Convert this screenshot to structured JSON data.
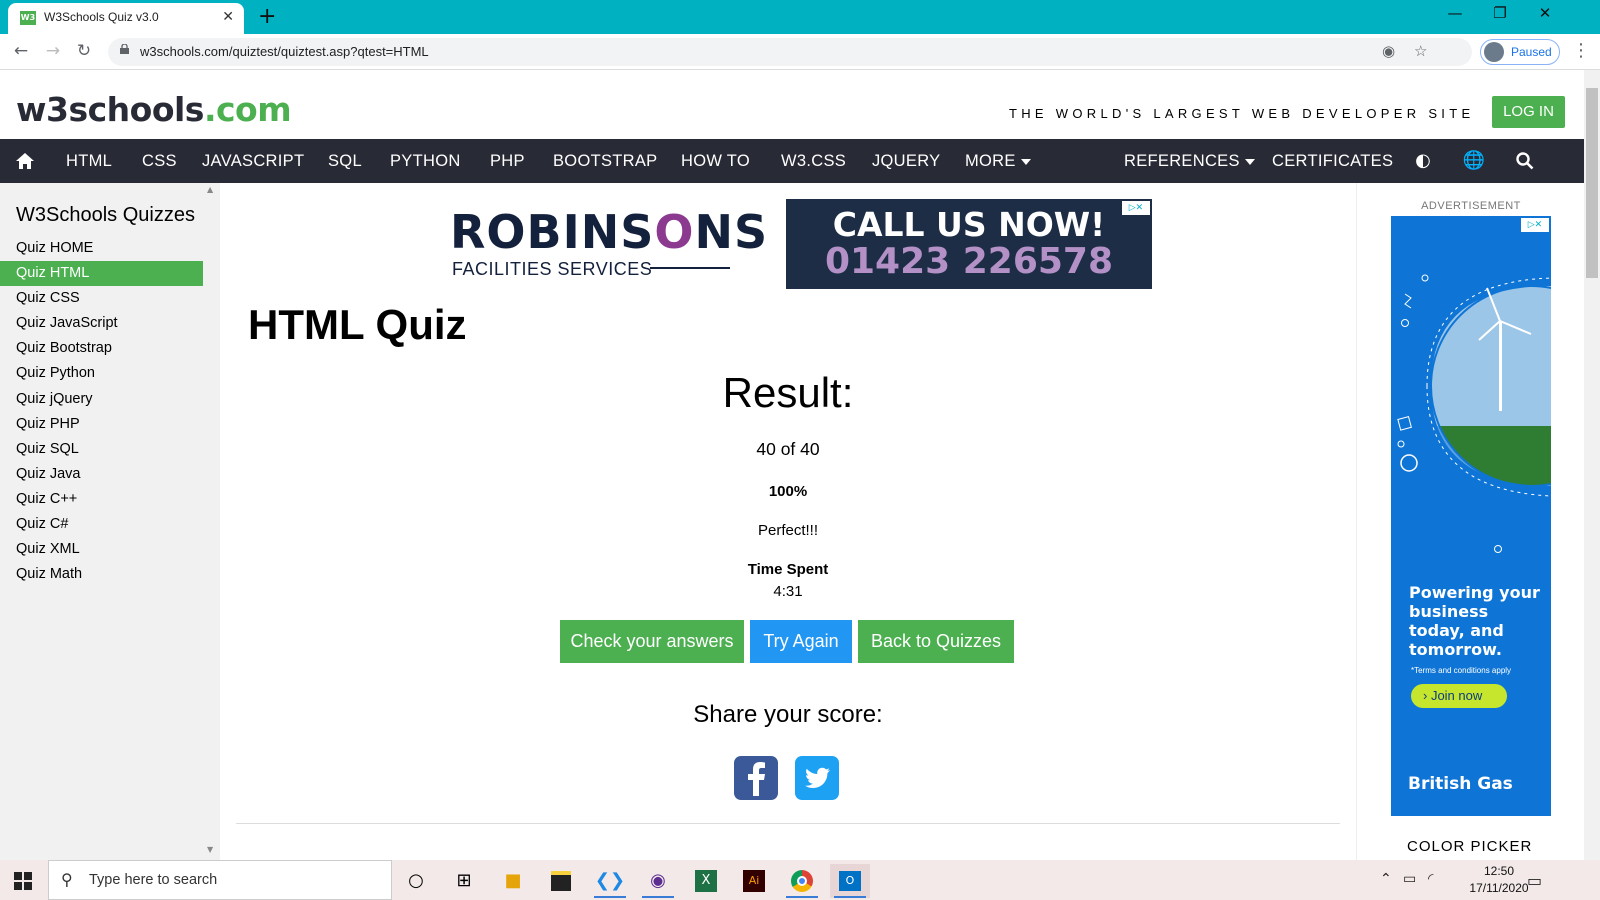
{
  "browser": {
    "tab_title": "W3Schools Quiz v3.0",
    "favicon_text": "W3",
    "url": "w3schools.com/quiztest/quiztest.asp?qtest=HTML",
    "profile_label": "Paused"
  },
  "header": {
    "logo_main": "w3schools",
    "logo_tld": ".com",
    "tagline": "THE WORLD'S LARGEST WEB DEVELOPER SITE",
    "login_label": "LOG IN"
  },
  "topnav": {
    "items": [
      "HTML",
      "CSS",
      "JAVASCRIPT",
      "SQL",
      "PYTHON",
      "PHP",
      "BOOTSTRAP",
      "HOW TO",
      "W3.CSS",
      "JQUERY",
      "MORE",
      "REFERENCES",
      "CERTIFICATES"
    ]
  },
  "sidebar": {
    "title": "W3Schools Quizzes",
    "items": [
      "Quiz HOME",
      "Quiz HTML",
      "Quiz CSS",
      "Quiz JavaScript",
      "Quiz Bootstrap",
      "Quiz Python",
      "Quiz jQuery",
      "Quiz PHP",
      "Quiz SQL",
      "Quiz Java",
      "Quiz C++",
      "Quiz C#",
      "Quiz XML",
      "Quiz Math"
    ],
    "active_index": 1
  },
  "banner_ad": {
    "brand_a": "ROBINS",
    "brand_o": "O",
    "brand_b": "NS",
    "subtitle": "FACILITIES SERVICES",
    "cta_line1": "CALL US NOW!",
    "cta_line2": "01423 226578"
  },
  "main": {
    "title": "HTML Quiz",
    "result_heading": "Result:",
    "score": "40 of 40",
    "percent": "100%",
    "comment": "Perfect!!!",
    "time_label": "Time Spent",
    "time_value": "4:31",
    "buttons": {
      "check": "Check your answers",
      "try_again": "Try Again",
      "back": "Back to Quizzes"
    },
    "share_label": "Share your score:"
  },
  "right_ad": {
    "label": "ADVERTISEMENT",
    "tagline": "Powering your business today, and tomorrow.",
    "terms": "*Terms and conditions apply",
    "join": "› Join now",
    "brand": "British Gas",
    "bottom_partial": "COLOR PICKER"
  },
  "taskbar": {
    "search_placeholder": "Type here to search",
    "time": "12:50",
    "date": "17/11/2020"
  },
  "colors": {
    "w3_green": "#4caf50",
    "nav_dark": "#282a35",
    "chrome_teal": "#00b1c1",
    "button_blue": "#2196f3"
  }
}
